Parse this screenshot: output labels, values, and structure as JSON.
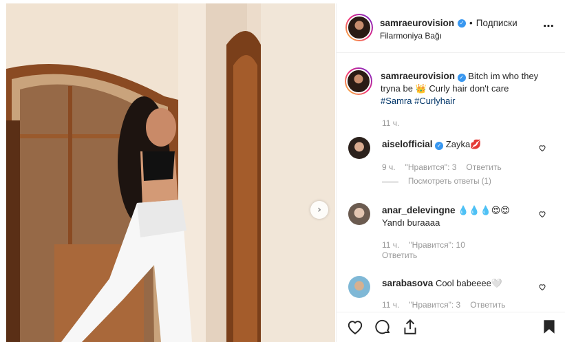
{
  "header": {
    "username": "samraeurovision",
    "separator": "•",
    "follow_label": "Подписки",
    "location": "Filarmoniya Bağı",
    "more_icon": "⋯"
  },
  "caption": {
    "username": "samraeurovision",
    "text": "Bitch im who they tryna be 👑 Curly hair don't care",
    "hashtags": [
      "#Samra",
      "#Curlyhair"
    ],
    "time": "11 ч."
  },
  "comments": [
    {
      "username": "aiselofficial",
      "verified": true,
      "text": "Zayka💋",
      "time": "9 ч.",
      "likes": "\"Нравится\": 3",
      "reply_label": "Ответить",
      "view_replies": "Посмотреть ответы (1)"
    },
    {
      "username": "anar_delevingne",
      "verified": false,
      "text": "💧💧💧😍😍",
      "text2": "Yandı buraaaa",
      "time": "11 ч.",
      "likes": "\"Нравится\": 10",
      "reply_label": "Ответить"
    },
    {
      "username": "sarabasova",
      "verified": false,
      "text": "Cool babeeee🤍",
      "time": "11 ч.",
      "likes": "\"Нравится\": 3",
      "reply_label": "Ответить"
    }
  ],
  "navigation": {
    "next_icon": "›"
  },
  "colors": {
    "link": "#003569",
    "verified": "#3897f0",
    "muted": "#999999",
    "border": "#efefef"
  }
}
